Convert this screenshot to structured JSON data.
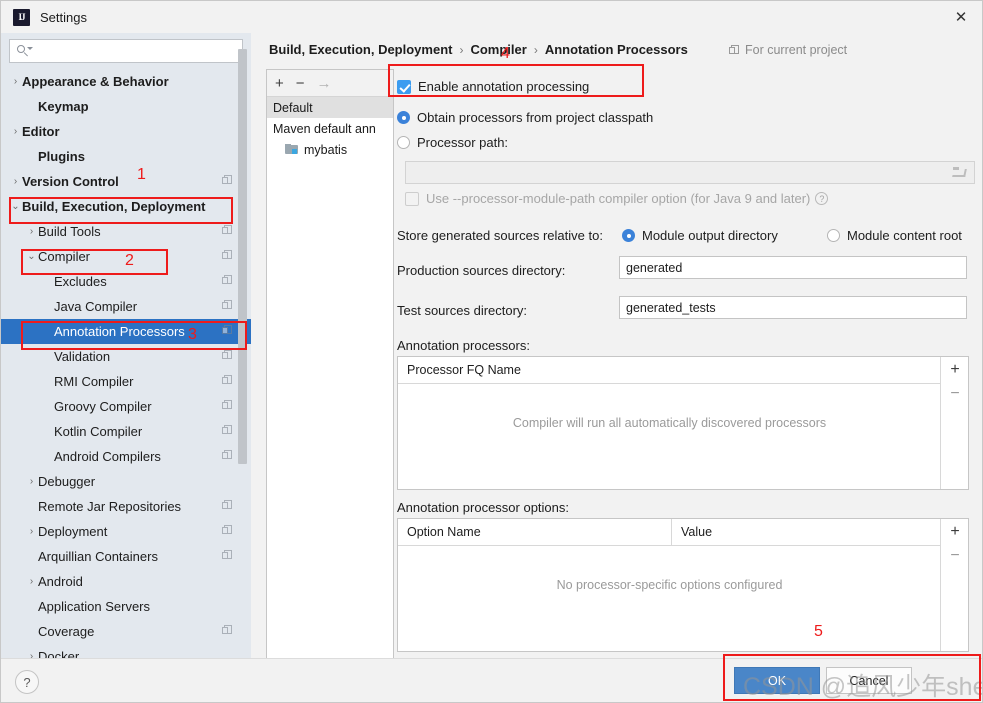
{
  "window": {
    "title": "Settings",
    "logo_text": "IJ",
    "close_label": "✕"
  },
  "search": {
    "value": "",
    "placeholder": ""
  },
  "sidebar": {
    "items": [
      {
        "label": "Appearance & Behavior",
        "arrow": "›",
        "bold": true,
        "indent": 0,
        "copy": false,
        "selected": false
      },
      {
        "label": "Keymap",
        "arrow": "",
        "bold": true,
        "indent": 1,
        "copy": false,
        "selected": false
      },
      {
        "label": "Editor",
        "arrow": "›",
        "bold": true,
        "indent": 0,
        "copy": false,
        "selected": false
      },
      {
        "label": "Plugins",
        "arrow": "",
        "bold": true,
        "indent": 1,
        "copy": false,
        "selected": false
      },
      {
        "label": "Version Control",
        "arrow": "›",
        "bold": true,
        "indent": 0,
        "copy": true,
        "selected": false
      },
      {
        "label": "Build, Execution, Deployment",
        "arrow": "⌄",
        "bold": true,
        "indent": 0,
        "copy": false,
        "selected": false
      },
      {
        "label": "Build Tools",
        "arrow": "›",
        "bold": false,
        "indent": 1,
        "copy": true,
        "selected": false
      },
      {
        "label": "Compiler",
        "arrow": "⌄",
        "bold": false,
        "indent": 1,
        "copy": true,
        "selected": false
      },
      {
        "label": "Excludes",
        "arrow": "",
        "bold": false,
        "indent": 2,
        "copy": true,
        "selected": false
      },
      {
        "label": "Java Compiler",
        "arrow": "",
        "bold": false,
        "indent": 2,
        "copy": true,
        "selected": false
      },
      {
        "label": "Annotation Processors",
        "arrow": "",
        "bold": false,
        "indent": 2,
        "copy": true,
        "selected": true
      },
      {
        "label": "Validation",
        "arrow": "",
        "bold": false,
        "indent": 2,
        "copy": true,
        "selected": false
      },
      {
        "label": "RMI Compiler",
        "arrow": "",
        "bold": false,
        "indent": 2,
        "copy": true,
        "selected": false
      },
      {
        "label": "Groovy Compiler",
        "arrow": "",
        "bold": false,
        "indent": 2,
        "copy": true,
        "selected": false
      },
      {
        "label": "Kotlin Compiler",
        "arrow": "",
        "bold": false,
        "indent": 2,
        "copy": true,
        "selected": false
      },
      {
        "label": "Android Compilers",
        "arrow": "",
        "bold": false,
        "indent": 2,
        "copy": true,
        "selected": false
      },
      {
        "label": "Debugger",
        "arrow": "›",
        "bold": false,
        "indent": 1,
        "copy": false,
        "selected": false
      },
      {
        "label": "Remote Jar Repositories",
        "arrow": "",
        "bold": false,
        "indent": 1,
        "copy": true,
        "selected": false
      },
      {
        "label": "Deployment",
        "arrow": "›",
        "bold": false,
        "indent": 1,
        "copy": true,
        "selected": false
      },
      {
        "label": "Arquillian Containers",
        "arrow": "",
        "bold": false,
        "indent": 1,
        "copy": true,
        "selected": false
      },
      {
        "label": "Android",
        "arrow": "›",
        "bold": false,
        "indent": 1,
        "copy": false,
        "selected": false
      },
      {
        "label": "Application Servers",
        "arrow": "",
        "bold": false,
        "indent": 1,
        "copy": false,
        "selected": false
      },
      {
        "label": "Coverage",
        "arrow": "",
        "bold": false,
        "indent": 1,
        "copy": true,
        "selected": false
      },
      {
        "label": "Docker",
        "arrow": "›",
        "bold": false,
        "indent": 1,
        "copy": false,
        "selected": false
      }
    ]
  },
  "breadcrumb": {
    "part1": "Build, Execution, Deployment",
    "sep1": "›",
    "part2": "Compiler",
    "sep2": "›",
    "part3": "Annotation Processors",
    "scope_label": "For current project"
  },
  "profiles": {
    "toolbar": {
      "add": "+",
      "remove": "−",
      "move": "→"
    },
    "items": [
      {
        "label": "Default",
        "selected": true,
        "folder": false
      },
      {
        "label": "Maven default ann",
        "selected": false,
        "folder": false
      },
      {
        "label": "mybatis",
        "selected": false,
        "folder": true
      }
    ]
  },
  "settings": {
    "enable_annotation_processing": "Enable annotation processing",
    "enable_checked": true,
    "obtain_from_classpath": "Obtain processors from project classpath",
    "obtain_selected": true,
    "processor_path_label": "Processor path:",
    "processor_path_selected": false,
    "processor_path_value": "",
    "module_path_option": "Use --processor-module-path compiler option (for Java 9 and later)",
    "module_path_checked": false,
    "help_glyph": "?",
    "store_label": "Store generated sources relative to:",
    "store_option_1": "Module output directory",
    "store_option_1_selected": true,
    "store_option_2": "Module content root",
    "store_option_2_selected": false,
    "production_label": "Production sources directory:",
    "production_value": "generated",
    "test_label": "Test sources directory:",
    "test_value": "generated_tests",
    "processors_caption": "Annotation processors:",
    "processors_col": "Processor FQ Name",
    "processors_empty": "Compiler will run all automatically discovered processors",
    "options_caption": "Annotation processor options:",
    "options_col_name": "Option Name",
    "options_col_value": "Value",
    "options_empty": "No processor-specific options configured",
    "add_glyph": "+",
    "remove_glyph": "−"
  },
  "footer": {
    "help": "?",
    "ok": "OK",
    "cancel": "Cancel"
  },
  "annotations": {
    "accent_color": "#ee1b1b",
    "numbers": [
      "1",
      "2",
      "3",
      "4",
      "5"
    ],
    "n1": "1",
    "n2": "2",
    "n3": "3",
    "n4": "4",
    "n5": "5"
  },
  "watermark": {
    "text": "CSDN @追风少年sherry"
  }
}
